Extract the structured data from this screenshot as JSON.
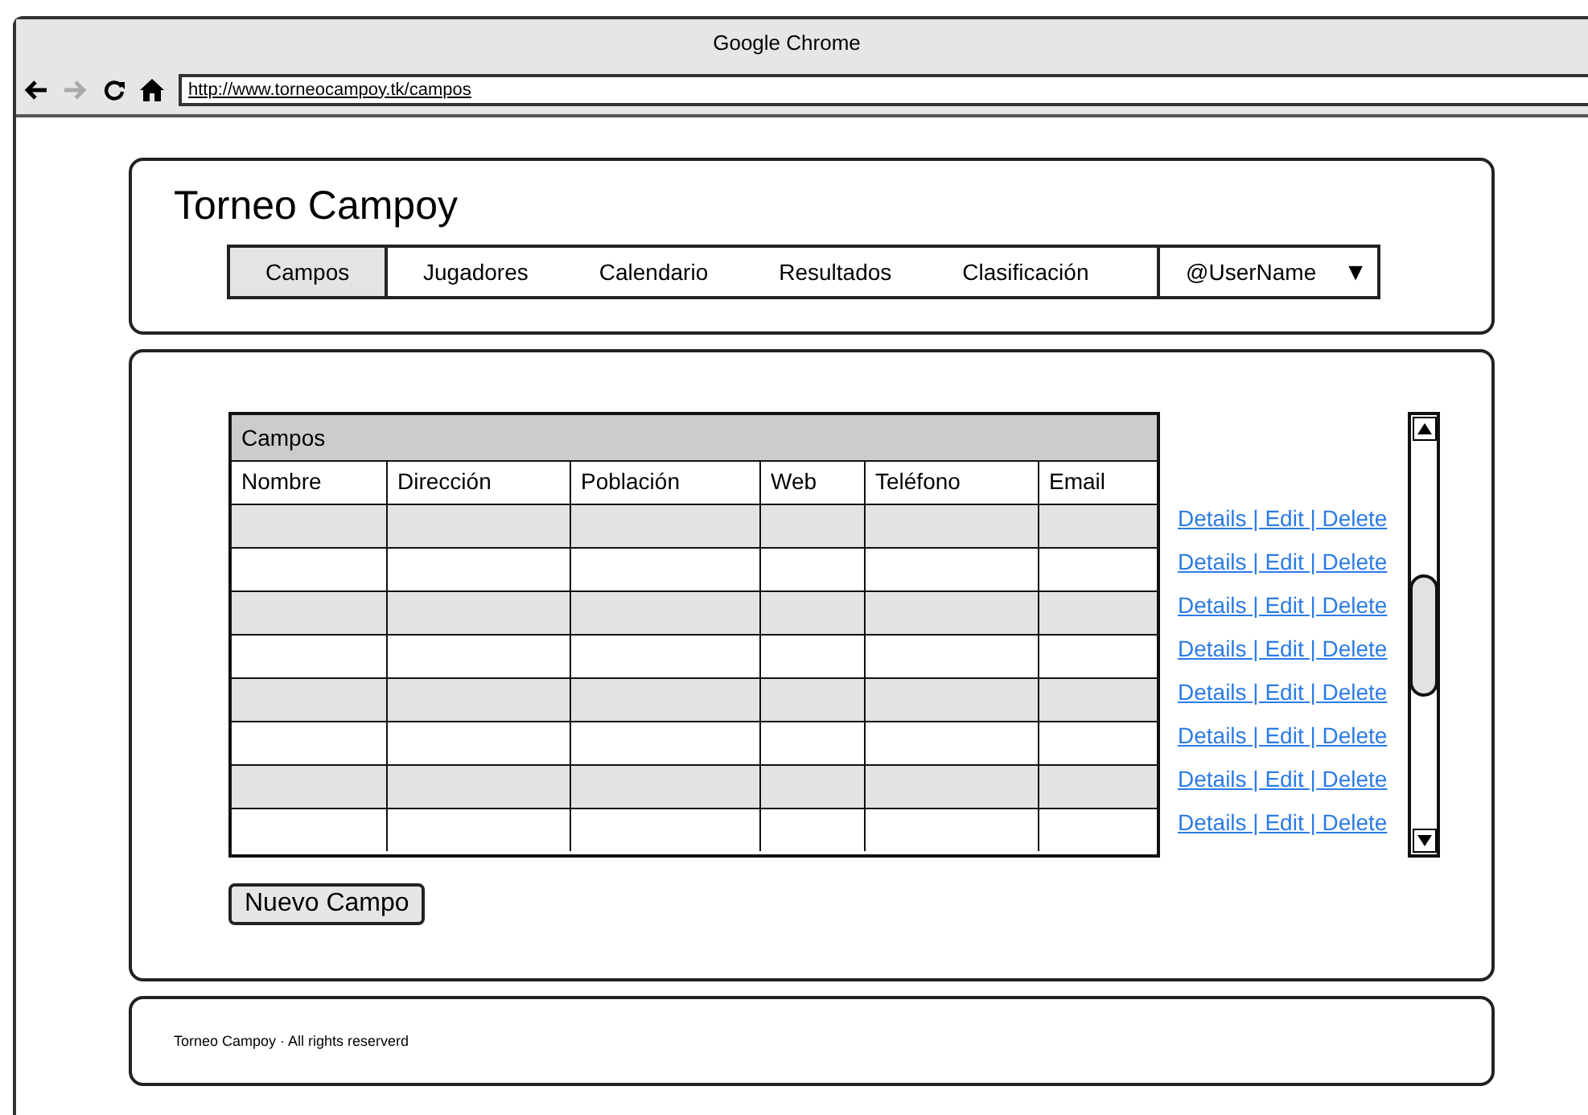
{
  "window": {
    "title": "Google Chrome",
    "url": "http://www.torneocampoy.tk/campos",
    "forward_disabled": true
  },
  "header": {
    "title": "Torneo Campoy",
    "tabs": [
      {
        "label": "Campos",
        "selected": true
      },
      {
        "label": "Jugadores",
        "selected": false
      },
      {
        "label": "Calendario",
        "selected": false
      },
      {
        "label": "Resultados",
        "selected": false
      },
      {
        "label": "Clasificación",
        "selected": false
      }
    ],
    "user_menu": {
      "label": "@UserName",
      "arrow": "▼"
    }
  },
  "table": {
    "title": "Campos",
    "columns": [
      "Nombre",
      "Dirección",
      "Población",
      "Web",
      "Teléfono",
      "Email"
    ],
    "rows": [
      {
        "shaded": true,
        "actions": "Details | Edit | Delete"
      },
      {
        "shaded": false,
        "actions": "Details | Edit | Delete"
      },
      {
        "shaded": true,
        "actions": "Details | Edit | Delete"
      },
      {
        "shaded": false,
        "actions": "Details | Edit | Delete"
      },
      {
        "shaded": true,
        "actions": "Details | Edit | Delete"
      },
      {
        "shaded": false,
        "actions": "Details | Edit | Delete"
      },
      {
        "shaded": true,
        "actions": "Details | Edit | Delete"
      },
      {
        "shaded": false,
        "actions": "Details | Edit | Delete"
      }
    ]
  },
  "new_button": "Nuevo Campo",
  "footer": "Torneo Campoy · All rights reserverd"
}
